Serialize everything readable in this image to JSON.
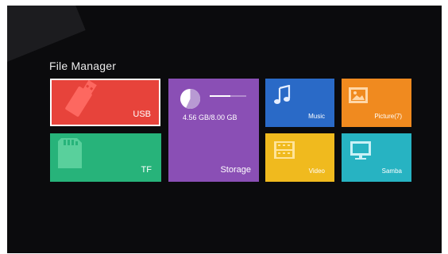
{
  "title": "File Manager",
  "tiles": {
    "usb": {
      "label": "USB",
      "color": "#e7433b",
      "icon": "usb-drive-icon"
    },
    "tf": {
      "label": "TF",
      "color": "#27b37a",
      "icon": "sd-card-icon"
    },
    "storage": {
      "usage": "4.56 GB/8.00 GB",
      "label": "Storage",
      "color": "#8a4fb5",
      "used_fraction": 0.57,
      "icon": "pie-chart-icon"
    },
    "music": {
      "label": "Music",
      "color": "#2a6ac7",
      "icon": "music-note-icon"
    },
    "picture": {
      "label": "Picture(7)",
      "color": "#f08a1f",
      "icon": "image-icon"
    },
    "video": {
      "label": "Video",
      "color": "#f0ba1e",
      "icon": "film-icon"
    },
    "samba": {
      "label": "Samba",
      "color": "#27b3c2",
      "icon": "monitor-icon"
    }
  }
}
